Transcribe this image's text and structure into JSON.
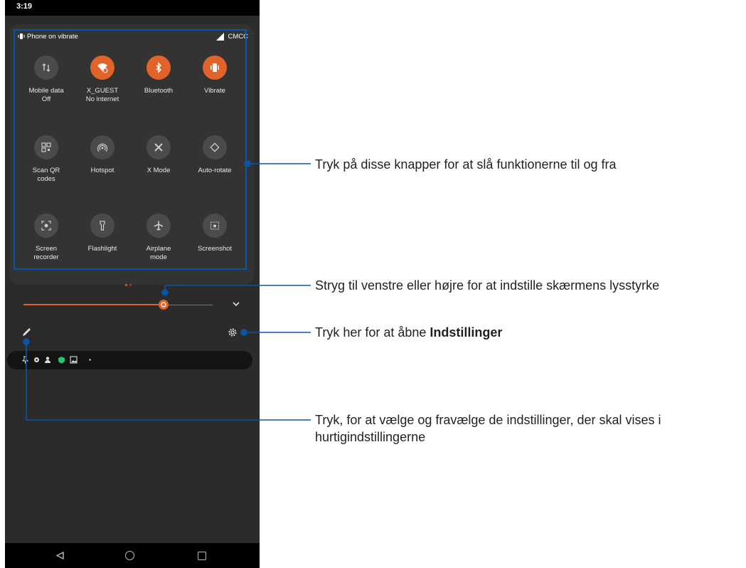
{
  "status_bar": {
    "time": "3:19"
  },
  "quick_settings": {
    "vibrate_status": "Phone on vibrate",
    "carrier": "CMCC",
    "tiles": [
      {
        "label": "Mobile data",
        "sublabel": "Off",
        "state": "off",
        "icon": "mobile-data-icon"
      },
      {
        "label": "X_GUEST",
        "sublabel": "No internet",
        "state": "on",
        "icon": "wifi-icon"
      },
      {
        "label": "Bluetooth",
        "sublabel": "",
        "state": "on",
        "icon": "bluetooth-icon"
      },
      {
        "label": "Vibrate",
        "sublabel": "",
        "state": "on",
        "icon": "vibrate-icon"
      },
      {
        "label": "Scan QR",
        "sublabel": "codes",
        "state": "off",
        "icon": "qr-code-icon"
      },
      {
        "label": "Hotspot",
        "sublabel": "",
        "state": "off",
        "icon": "hotspot-icon"
      },
      {
        "label": "X Mode",
        "sublabel": "",
        "state": "off",
        "icon": "x-mode-icon"
      },
      {
        "label": "Auto-rotate",
        "sublabel": "",
        "state": "off",
        "icon": "auto-rotate-icon"
      },
      {
        "label": "Screen",
        "sublabel": "recorder",
        "state": "off",
        "icon": "screen-recorder-icon"
      },
      {
        "label": "Flashlight",
        "sublabel": "",
        "state": "off",
        "icon": "flashlight-icon"
      },
      {
        "label": "Airplane",
        "sublabel": "mode",
        "state": "off",
        "icon": "airplane-icon"
      },
      {
        "label": "Screenshot",
        "sublabel": "",
        "state": "off",
        "icon": "screenshot-icon"
      }
    ],
    "page_indicator": {
      "pages": 2,
      "current": 1
    }
  },
  "brightness": {
    "level": 0.74
  },
  "colors": {
    "accent": "#e2632a",
    "highlight": "#0b55a6",
    "panel": "#333333"
  },
  "callouts": {
    "tiles": "Tryk på disse knapper for at slå funktionerne til og fra",
    "brightness": "Stryg til venstre eller højre for at indstille skærmens lysstyrke",
    "settings_prefix": "Tryk her for at åbne ",
    "settings_bold": "Indstillinger",
    "edit_line1": "Tryk, for at vælge og fravælge de indstillinger, der skal vises i",
    "edit_line2": "hurtigindstillingerne"
  }
}
